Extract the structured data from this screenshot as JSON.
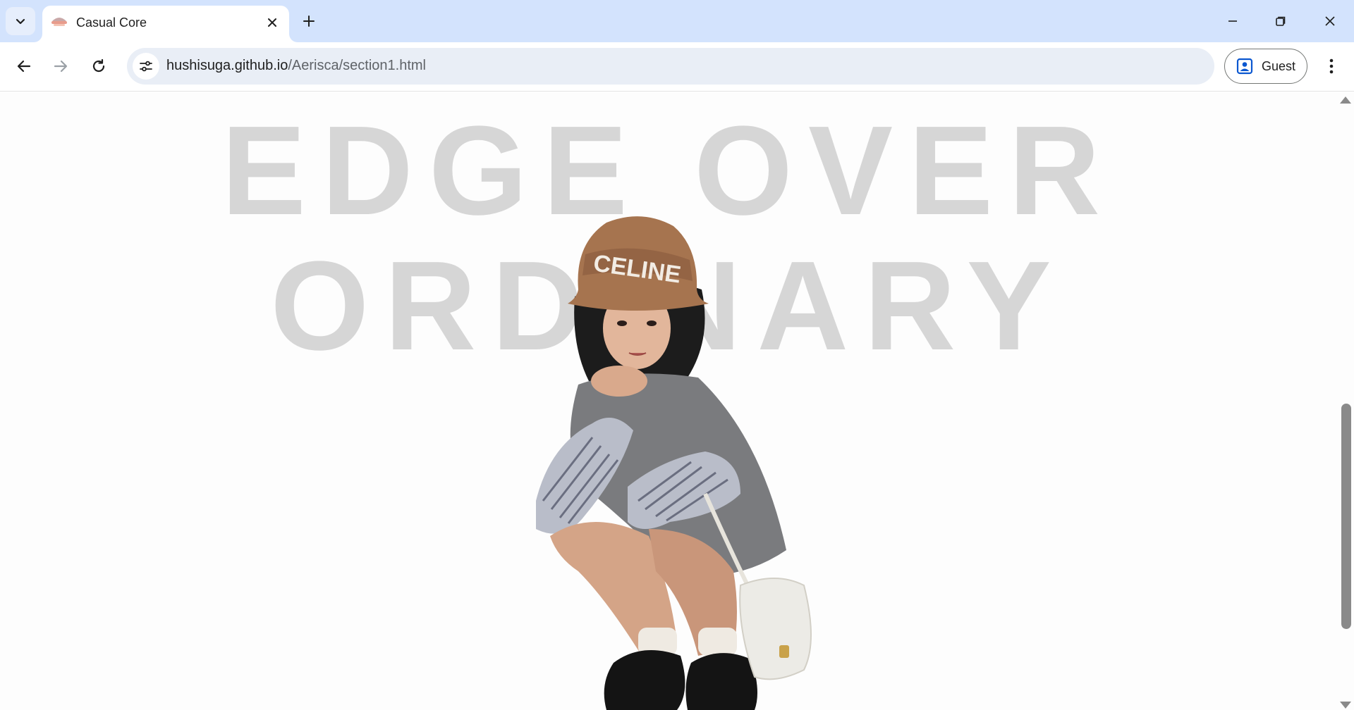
{
  "browser": {
    "tab": {
      "title": "Casual Core"
    },
    "address": {
      "host": "hushisuga.github.io",
      "path": "/Aerisca/section1.html"
    },
    "profile_label": "Guest"
  },
  "page": {
    "hero_line1": "EDGE OVER",
    "hero_line2": "ORDINARY",
    "hat_text": "CELINE",
    "background_color": "#fdfdfd",
    "hero_text_color": "#d6d6d6"
  },
  "icons": [
    "tab-search-icon",
    "favicon-icon",
    "close-icon",
    "plus-icon",
    "minimize-icon",
    "restore-icon",
    "window-close-icon",
    "back-arrow-icon",
    "forward-arrow-icon",
    "reload-icon",
    "site-settings-icon",
    "profile-icon",
    "kebab-menu-icon"
  ]
}
